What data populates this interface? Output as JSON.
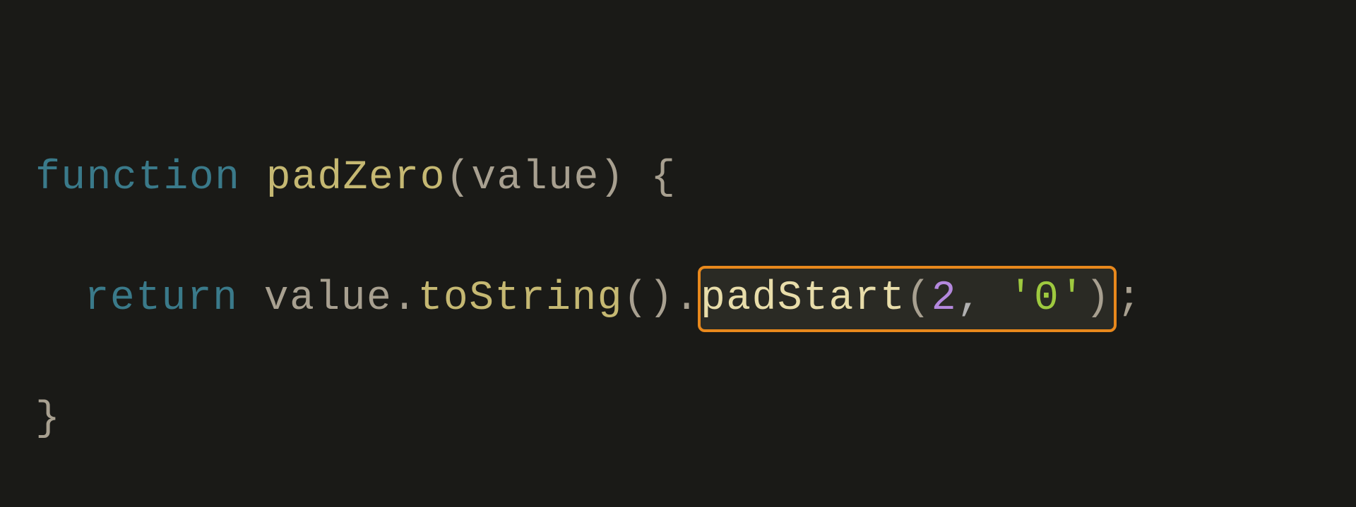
{
  "code": {
    "line1": {
      "keyword": "function",
      "functionName": "padZero",
      "param": "value"
    },
    "line2": {
      "keyword": "return",
      "variable": "value",
      "method1": "toString",
      "method2": "padStart",
      "arg1": "2",
      "arg2": "'0'"
    }
  }
}
